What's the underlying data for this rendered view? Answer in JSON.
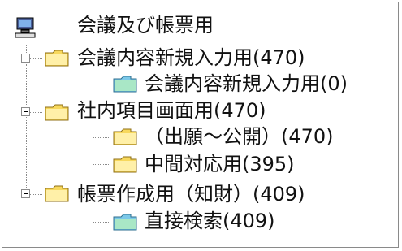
{
  "tree": {
    "root": {
      "icon": "computer-icon",
      "label": "会議及び帳票用"
    },
    "node1": {
      "label": "会議内容新規入力用(470)",
      "icon": "folder-icon",
      "children": [
        {
          "label": "会議内容新規入力用(0)",
          "icon": "folder-special-icon"
        }
      ]
    },
    "node2": {
      "label": "社内項目画面用(470)",
      "icon": "folder-icon",
      "children": [
        {
          "label": "（出願〜公開）(470)",
          "icon": "folder-icon"
        },
        {
          "label": "中間対応用(395)",
          "icon": "folder-icon"
        }
      ]
    },
    "node3": {
      "label": "帳票作成用（知財）(409)",
      "icon": "folder-icon",
      "children": [
        {
          "label": "直接検索(409)",
          "icon": "folder-special-icon"
        }
      ]
    }
  },
  "colors": {
    "folder_yellow": "#F7D85D",
    "folder_yellow_light": "#FFF0A8",
    "folder_special": "#7BC8E8",
    "border": "#8A8A8A"
  }
}
